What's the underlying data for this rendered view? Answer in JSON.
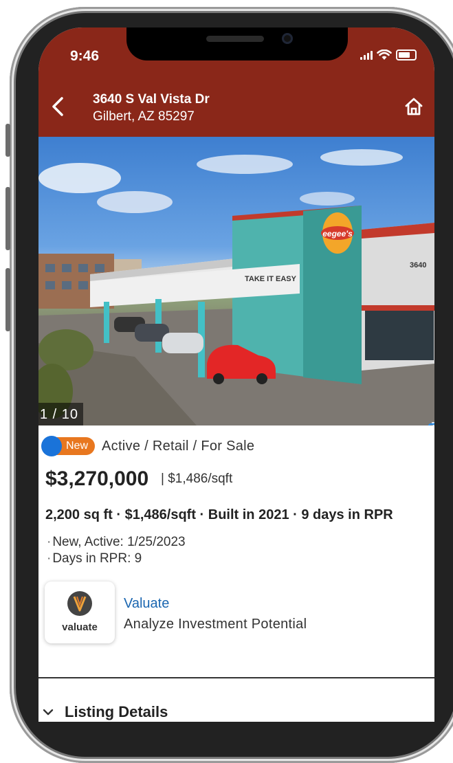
{
  "status_bar": {
    "time": "9:46"
  },
  "header": {
    "address_line1": "3640 S Val Vista Dr",
    "address_line2": "Gilbert, AZ 85297"
  },
  "photo": {
    "counter": "1 / 10",
    "signage": {
      "brand": "eegee's",
      "slogan": "TAKE IT EASY",
      "number": "3640"
    },
    "tools": [
      "street-view-icon",
      "airplane-icon",
      "camera-icon"
    ]
  },
  "listing": {
    "badge": "New",
    "status": "Active / Retail / For Sale",
    "price": "$3,270,000",
    "price_per_sqft": "| $1,486/sqft",
    "facts": "2,200 sq ft · $1,486/sqft · Built in 2021 · 9 days in RPR",
    "notes": [
      "New, Active: 1/25/2023",
      "Days in RPR: 9"
    ]
  },
  "valuate": {
    "logo_text": "valuate",
    "title": "Valuate",
    "subtitle": "Analyze Investment Potential"
  },
  "section": {
    "label": "Listing Details"
  },
  "colors": {
    "header": "#8a2719",
    "accent_blue": "#1a73d9",
    "badge_orange": "#e8771f",
    "link": "#1a66b0"
  }
}
